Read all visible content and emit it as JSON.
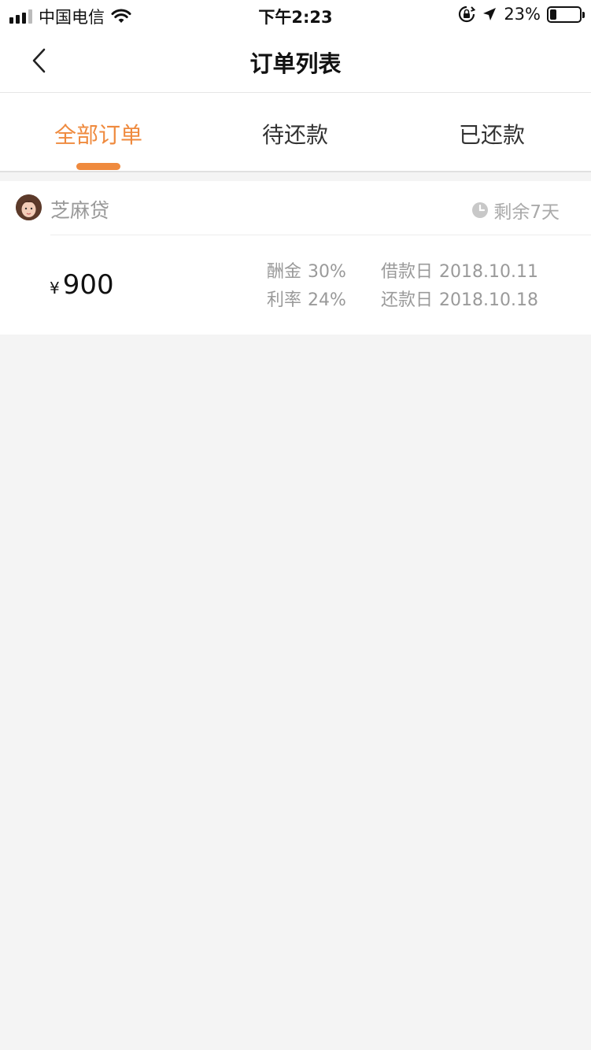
{
  "status_bar": {
    "carrier": "中国电信",
    "time": "下午2:23",
    "battery_percent": "23%",
    "battery_level": 0.23
  },
  "nav": {
    "title": "订单列表"
  },
  "tabs": [
    {
      "label": "全部订单",
      "active": true
    },
    {
      "label": "待还款",
      "active": false
    },
    {
      "label": "已还款",
      "active": false
    }
  ],
  "colors": {
    "accent": "#ef8a3e",
    "background": "#f4f4f4"
  },
  "order": {
    "lender": "芝麻贷",
    "remaining": "剩余7天",
    "currency_symbol": "¥",
    "amount": "900",
    "commission_label": "酬金",
    "commission_value": "30%",
    "rate_label": "利率",
    "rate_value": "24%",
    "borrow_date_label": "借款日",
    "borrow_date_value": "2018.10.11",
    "repay_date_label": "还款日",
    "repay_date_value": "2018.10.18"
  }
}
